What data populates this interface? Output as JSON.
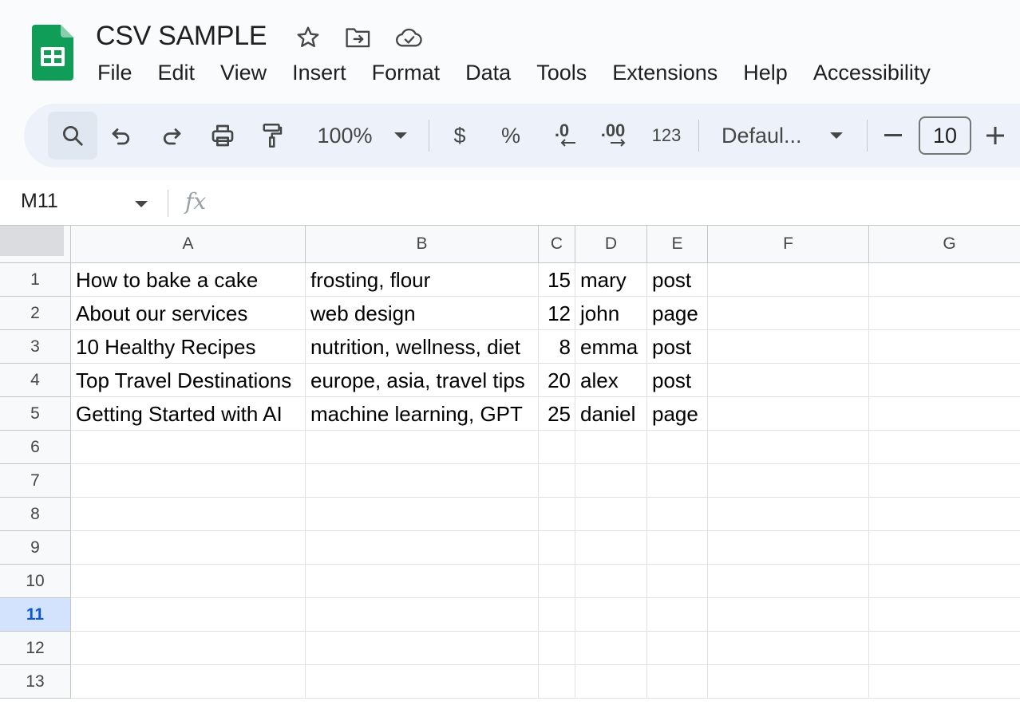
{
  "doc": {
    "title": "CSV SAMPLE",
    "icons": [
      "star-icon",
      "move-folder-icon",
      "cloud-saved-icon"
    ]
  },
  "menu": [
    "File",
    "Edit",
    "View",
    "Insert",
    "Format",
    "Data",
    "Tools",
    "Extensions",
    "Help",
    "Accessibility"
  ],
  "toolbar": {
    "zoom": "100%",
    "currency": "$",
    "percent": "%",
    "decrease_decimal": ".0",
    "increase_decimal": ".00",
    "number_format": "123",
    "font": "Defaul...",
    "minus": "−",
    "font_size": "10",
    "plus": "+"
  },
  "formula_bar": {
    "cell_ref": "M11",
    "fx": "fx",
    "value": ""
  },
  "sheet": {
    "columns": [
      "A",
      "B",
      "C",
      "D",
      "E",
      "F",
      "G"
    ],
    "row_numbers": [
      "1",
      "2",
      "3",
      "4",
      "5",
      "6",
      "7",
      "8",
      "9",
      "10",
      "11",
      "12",
      "13"
    ],
    "selected_row": "11",
    "rows": [
      [
        "How to bake a cake",
        "frosting, flour",
        "15",
        "mary",
        "post",
        "",
        ""
      ],
      [
        "About our services",
        "web design",
        "12",
        "john",
        "page",
        "",
        ""
      ],
      [
        "10 Healthy Recipes",
        "nutrition, wellness, diet",
        "8",
        "emma",
        "post",
        "",
        ""
      ],
      [
        "Top Travel Destinations",
        "europe, asia, travel tips",
        "20",
        "alex",
        "post",
        "",
        ""
      ],
      [
        "Getting Started with AI",
        "machine learning, GPT",
        "25",
        "daniel",
        "page",
        "",
        ""
      ]
    ]
  },
  "colors": {
    "brand_green": "#0f9d58",
    "selected_row_bg": "#d3e3fd",
    "selected_row_text": "#0b57d0",
    "toolbar_bg": "#edf2fa"
  }
}
